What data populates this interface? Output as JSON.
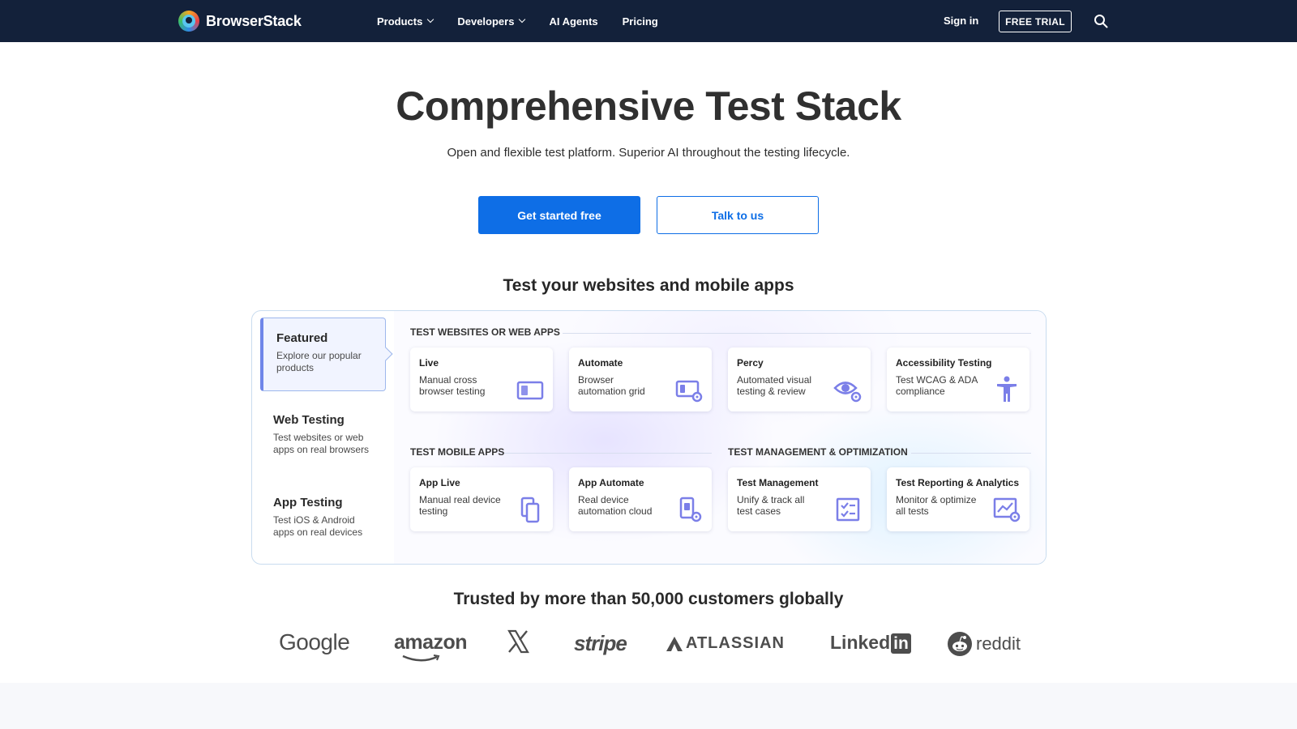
{
  "header": {
    "brand": "BrowserStack",
    "nav": [
      {
        "label": "Products",
        "has_dropdown": true
      },
      {
        "label": "Developers",
        "has_dropdown": true
      },
      {
        "label": "AI Agents",
        "has_dropdown": false
      },
      {
        "label": "Pricing",
        "has_dropdown": false
      }
    ],
    "sign_in": "Sign in",
    "free_trial": "FREE TRIAL",
    "search_icon": "search-icon"
  },
  "hero": {
    "title": "Comprehensive Test Stack",
    "subtitle": "Open and flexible test platform. Superior AI throughout the testing lifecycle.",
    "cta_primary": "Get started free",
    "cta_secondary": "Talk to us"
  },
  "products": {
    "section_title": "Test your websites and mobile apps",
    "tabs": [
      {
        "title": "Featured",
        "desc": "Explore our popular products",
        "active": true
      },
      {
        "title": "Web Testing",
        "desc": "Test websites or web apps on real browsers",
        "active": false
      },
      {
        "title": "App Testing",
        "desc": "Test iOS & Android apps on real devices",
        "active": false
      }
    ],
    "groups": {
      "web": "TEST WEBSITES OR WEB APPS",
      "mobile": "TEST MOBILE APPS",
      "management": "TEST MANAGEMENT & OPTIMIZATION"
    },
    "cards": [
      {
        "title": "Live",
        "desc": "Manual cross browser testing",
        "icon": "browser-window-icon"
      },
      {
        "title": "Automate",
        "desc": "Browser automation grid",
        "icon": "browser-gear-icon"
      },
      {
        "title": "Percy",
        "desc": "Automated visual testing & review",
        "icon": "eye-gear-icon"
      },
      {
        "title": "Accessibility Testing",
        "desc": "Test WCAG & ADA compliance",
        "icon": "accessibility-icon"
      },
      {
        "title": "App Live",
        "desc": "Manual real device testing",
        "icon": "devices-icon"
      },
      {
        "title": "App Automate",
        "desc": "Real device automation cloud",
        "icon": "device-gear-icon"
      },
      {
        "title": "Test Management",
        "desc": "Unify & track all test cases",
        "icon": "checklist-icon"
      },
      {
        "title": "Test Reporting & Analytics",
        "desc": "Monitor & optimize all tests",
        "icon": "chart-gear-icon"
      }
    ],
    "icon_color": "#7b7fe8"
  },
  "trusted": {
    "title": "Trusted by more than 50,000 customers globally",
    "logos": {
      "google": "Google",
      "amazon": "amazon",
      "x": "X",
      "stripe": "stripe",
      "atlassian": "ATLASSIAN",
      "linkedin_a": "Linked",
      "linkedin_b": "in",
      "reddit": "reddit"
    }
  },
  "colors": {
    "header_bg": "#13213a",
    "primary": "#0e6ee6",
    "icon": "#7b7fe8"
  }
}
